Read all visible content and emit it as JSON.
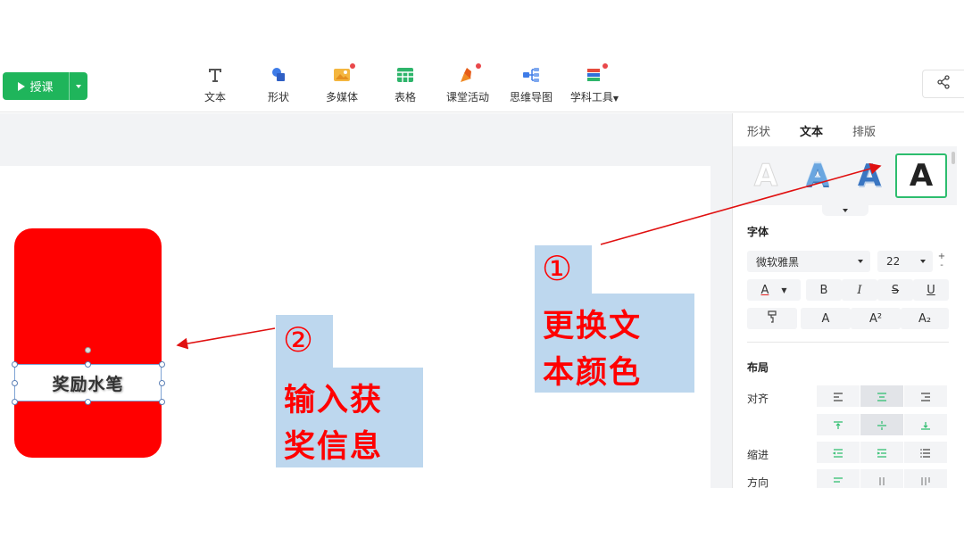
{
  "toolbar": {
    "start_label": "授课",
    "tools": [
      {
        "label": "文本",
        "icon": "text-icon"
      },
      {
        "label": "形状",
        "icon": "shape-icon"
      },
      {
        "label": "多媒体",
        "icon": "media-icon"
      },
      {
        "label": "表格",
        "icon": "table-icon"
      },
      {
        "label": "课堂活动",
        "icon": "activity-icon"
      },
      {
        "label": "思维导图",
        "icon": "mindmap-icon"
      },
      {
        "label": "学科工具",
        "icon": "subject-tools-icon"
      }
    ],
    "share_icon": "share-icon",
    "colors": {
      "accent": "#1fb55b",
      "badge": "#e9474a"
    }
  },
  "slide": {
    "text_box_value": "奖励水笔",
    "card_color": "#ff0000"
  },
  "annotations": {
    "note1": {
      "number": "①",
      "lines": [
        "更换文",
        "本颜色"
      ]
    },
    "note2": {
      "number": "②",
      "lines": [
        "输入获",
        "奖信息"
      ]
    },
    "color": "#ff0000",
    "background": "#bdd7ee"
  },
  "panel": {
    "tabs": [
      "形状",
      "文本",
      "排版"
    ],
    "active_tab": "文本",
    "text_styles": [
      "A",
      "A",
      "A",
      "A"
    ],
    "font_section": "字体",
    "font_family": "微软雅黑",
    "font_size": "22",
    "stepper_up": "+",
    "stepper_down": "-",
    "format_buttons": [
      "A",
      "B",
      "I",
      "S",
      "U"
    ],
    "effect_buttons": [
      "A",
      "A²",
      "A₂"
    ],
    "layout_section": "布局",
    "align_label": "对齐",
    "indent_label": "缩进",
    "direction_label": "方向",
    "selected_alignment": {
      "horizontal": "center",
      "vertical": "middle"
    }
  }
}
